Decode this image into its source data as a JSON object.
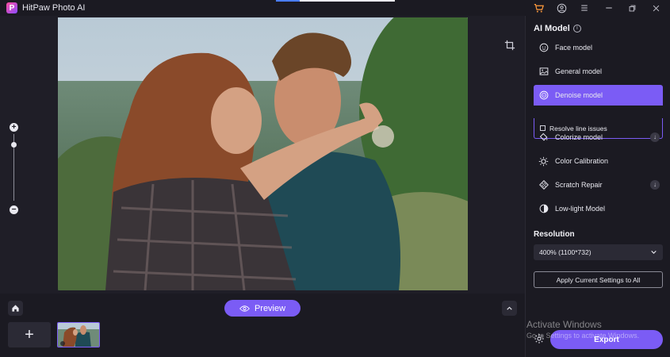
{
  "app": {
    "title": "HitPaw Photo AI",
    "logo_letter": "P"
  },
  "titlebar": {
    "progress_percent": 20,
    "icons": [
      "cart-icon",
      "account-icon",
      "menu-icon",
      "minimize-icon",
      "maximize-icon",
      "close-icon"
    ]
  },
  "canvas": {
    "zoom_plus": "+",
    "zoom_minus": "−",
    "zoom_level_fraction": 0.88
  },
  "bottom": {
    "preview_label": "Preview",
    "add_label": "+"
  },
  "panel": {
    "title": "AI Model",
    "models": [
      {
        "label": "Face model",
        "icon": "face-icon",
        "downloadable": false,
        "active": false
      },
      {
        "label": "General model",
        "icon": "image-icon",
        "downloadable": false,
        "active": false
      },
      {
        "label": "Denoise model",
        "icon": "denoise-icon",
        "downloadable": false,
        "active": true
      },
      {
        "label": "Colorize model",
        "icon": "paint-bucket-icon",
        "downloadable": true,
        "active": false
      },
      {
        "label": "Color Calibration",
        "icon": "sun-icon",
        "downloadable": false,
        "active": false
      },
      {
        "label": "Scratch Repair",
        "icon": "scratch-icon",
        "downloadable": true,
        "active": false
      },
      {
        "label": "Low-light Model",
        "icon": "contrast-icon",
        "downloadable": false,
        "active": false
      }
    ],
    "sub_option": {
      "label": "Resolve line issues",
      "checked": false
    },
    "resolution": {
      "title": "Resolution",
      "value": "400% (1100*732)"
    },
    "apply_label": "Apply Current Settings to All",
    "export_label": "Export"
  },
  "watermark": {
    "line1": "Activate Windows",
    "line2": "Go to Settings to activate Windows."
  },
  "colors": {
    "accent": "#7b5cf5",
    "background": "#1b1a22",
    "panel_button": "#2b2a35"
  }
}
